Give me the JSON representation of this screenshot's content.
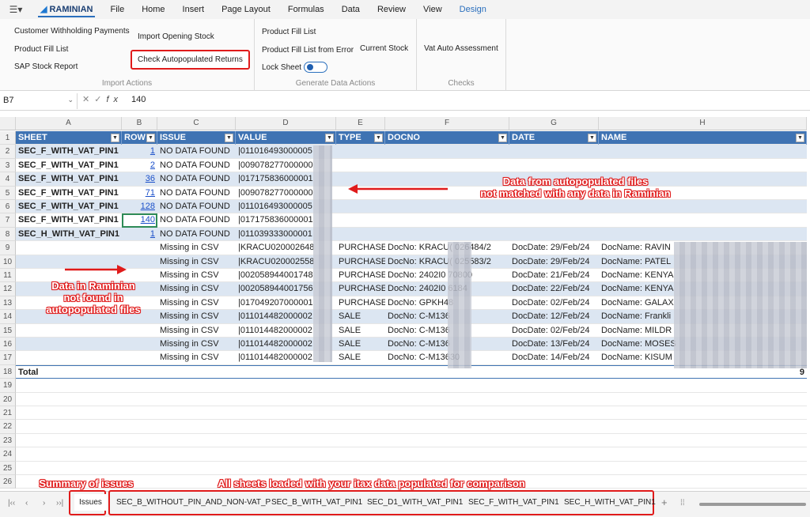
{
  "ribbon_tabs": {
    "brand": "RAMINIAN",
    "items": [
      "File",
      "Home",
      "Insert",
      "Page Layout",
      "Formulas",
      "Data",
      "Review",
      "View",
      "Design"
    ]
  },
  "ribbon": {
    "import": {
      "label": "Import Actions",
      "customer_withholding": "Customer Withholding Payments",
      "product_fill_list": "Product Fill List",
      "sap_stock_report": "SAP Stock Report",
      "import_opening_stock": "Import Opening Stock",
      "check_autopopulated": "Check Autopopulated Returns"
    },
    "generate": {
      "label": "Generate Data Actions",
      "product_fill_list": "Product Fill List",
      "product_fill_list_error": "Product Fill List from Error",
      "current_stock": "Current Stock",
      "lock_sheet": "Lock Sheet"
    },
    "checks": {
      "label": "Checks",
      "vat_auto_assessment": "Vat Auto Assessment"
    }
  },
  "formula_bar": {
    "name_box": "B7",
    "value": "140"
  },
  "columns": [
    "A",
    "B",
    "C",
    "D",
    "E",
    "F",
    "G",
    "H"
  ],
  "headers": [
    "SHEET",
    "ROW",
    "ISSUE",
    "VALUE",
    "TYPE",
    "DOCNO",
    "DATE",
    "NAME"
  ],
  "rows": [
    {
      "n": "2",
      "sheet": "SEC_F_WITH_VAT_PIN1",
      "row": "1",
      "issue": "NO DATA FOUND",
      "value": "|011016493000005",
      "type": "",
      "docno": "",
      "date": "",
      "name": ""
    },
    {
      "n": "3",
      "sheet": "SEC_F_WITH_VAT_PIN1",
      "row": "2",
      "issue": "NO DATA FOUND",
      "value": "|009078277000000",
      "type": "",
      "docno": "",
      "date": "",
      "name": ""
    },
    {
      "n": "4",
      "sheet": "SEC_F_WITH_VAT_PIN1",
      "row": "36",
      "issue": "NO DATA FOUND",
      "value": "|017175836000001",
      "type": "",
      "docno": "",
      "date": "",
      "name": ""
    },
    {
      "n": "5",
      "sheet": "SEC_F_WITH_VAT_PIN1",
      "row": "71",
      "issue": "NO DATA FOUND",
      "value": "|009078277000000",
      "type": "",
      "docno": "",
      "date": "",
      "name": ""
    },
    {
      "n": "6",
      "sheet": "SEC_F_WITH_VAT_PIN1",
      "row": "128",
      "issue": "NO DATA FOUND",
      "value": "|011016493000005",
      "type": "",
      "docno": "",
      "date": "",
      "name": ""
    },
    {
      "n": "7",
      "sheet": "SEC_F_WITH_VAT_PIN1",
      "row": "140",
      "issue": "NO DATA FOUND",
      "value": "|017175836000001",
      "type": "",
      "docno": "",
      "date": "",
      "name": ""
    },
    {
      "n": "8",
      "sheet": "SEC_H_WITH_VAT_PIN1",
      "row": "1",
      "issue": "NO DATA FOUND",
      "value": "|011039333000001",
      "type": "",
      "docno": "",
      "date": "",
      "name": ""
    },
    {
      "n": "9",
      "sheet": "",
      "row": "",
      "issue": "Missing in CSV",
      "value": "|KRACU020002648",
      "type": "PURCHASE",
      "docno": "DocNo: KRACU(        026484/2",
      "date": "DocDate: 29/Feb/24",
      "name": "DocName: RAVIN"
    },
    {
      "n": "10",
      "sheet": "",
      "row": "",
      "issue": "Missing in CSV",
      "value": "|KRACU020002558",
      "type": "PURCHASE",
      "docno": "DocNo: KRACU(        025583/2",
      "date": "DocDate: 29/Feb/24",
      "name": "DocName: PATEL"
    },
    {
      "n": "11",
      "sheet": "",
      "row": "",
      "issue": "Missing in CSV",
      "value": "|002058944001748",
      "type": "PURCHASE",
      "docno": "DocNo: 2402I0        70800",
      "date": "DocDate: 21/Feb/24",
      "name": "DocName: KENYA"
    },
    {
      "n": "12",
      "sheet": "",
      "row": "",
      "issue": "Missing in CSV",
      "value": "|002058944001756",
      "type": "PURCHASE",
      "docno": "DocNo: 2402I0        6184",
      "date": "DocDate: 22/Feb/24",
      "name": "DocName: KENYA"
    },
    {
      "n": "13",
      "sheet": "",
      "row": "",
      "issue": "Missing in CSV",
      "value": "|017049207000001",
      "type": "PURCHASE",
      "docno": "DocNo: GPKH48",
      "date": "DocDate: 02/Feb/24",
      "name": "DocName: GALAX"
    },
    {
      "n": "14",
      "sheet": "",
      "row": "",
      "issue": "Missing in CSV",
      "value": "|011014482000002",
      "type": "SALE",
      "docno": "DocNo: C-M136",
      "date": "DocDate: 12/Feb/24",
      "name": "DocName: Frankli"
    },
    {
      "n": "15",
      "sheet": "",
      "row": "",
      "issue": "Missing in CSV",
      "value": "|011014482000002",
      "type": "SALE",
      "docno": "DocNo: C-M136",
      "date": "DocDate: 02/Feb/24",
      "name": "DocName: MILDR"
    },
    {
      "n": "16",
      "sheet": "",
      "row": "",
      "issue": "Missing in CSV",
      "value": "|011014482000002",
      "type": "SALE",
      "docno": "DocNo: C-M136",
      "date": "DocDate: 13/Feb/24",
      "name": "DocName: MOSES"
    },
    {
      "n": "17",
      "sheet": "",
      "row": "",
      "issue": "Missing in CSV",
      "value": "|011014482000002",
      "type": "SALE",
      "docno": "DocNo: C-M13630",
      "date": "DocDate: 14/Feb/24",
      "name": "DocName: KISUM"
    }
  ],
  "total": {
    "n": "18",
    "label": "Total",
    "count": "9"
  },
  "empty_rows": [
    "19",
    "20",
    "21",
    "22",
    "23",
    "24",
    "25",
    "26"
  ],
  "annotations": {
    "not_matched": "Data from autopopulated files\nnot matched with any data in Raminian",
    "not_found": "Data in Raminian\nnot found in\nautopopulated files",
    "summary": "Summary of issues",
    "all_sheets": "All sheets loaded with your itax data populated for comparison"
  },
  "sheet_tabs": [
    "Issues",
    "SEC_B_WITHOUT_PIN_AND_NON-VAT_P",
    "SEC_B_WITH_VAT_PIN1",
    "SEC_D1_WITH_VAT_PIN1",
    "SEC_F_WITH_VAT_PIN1",
    "SEC_H_WITH_VAT_PIN1"
  ],
  "colors": {
    "header": "#3f73b3",
    "band": "#dce6f2",
    "highlight": "#e01b1b",
    "accent": "#2a6fbd"
  }
}
